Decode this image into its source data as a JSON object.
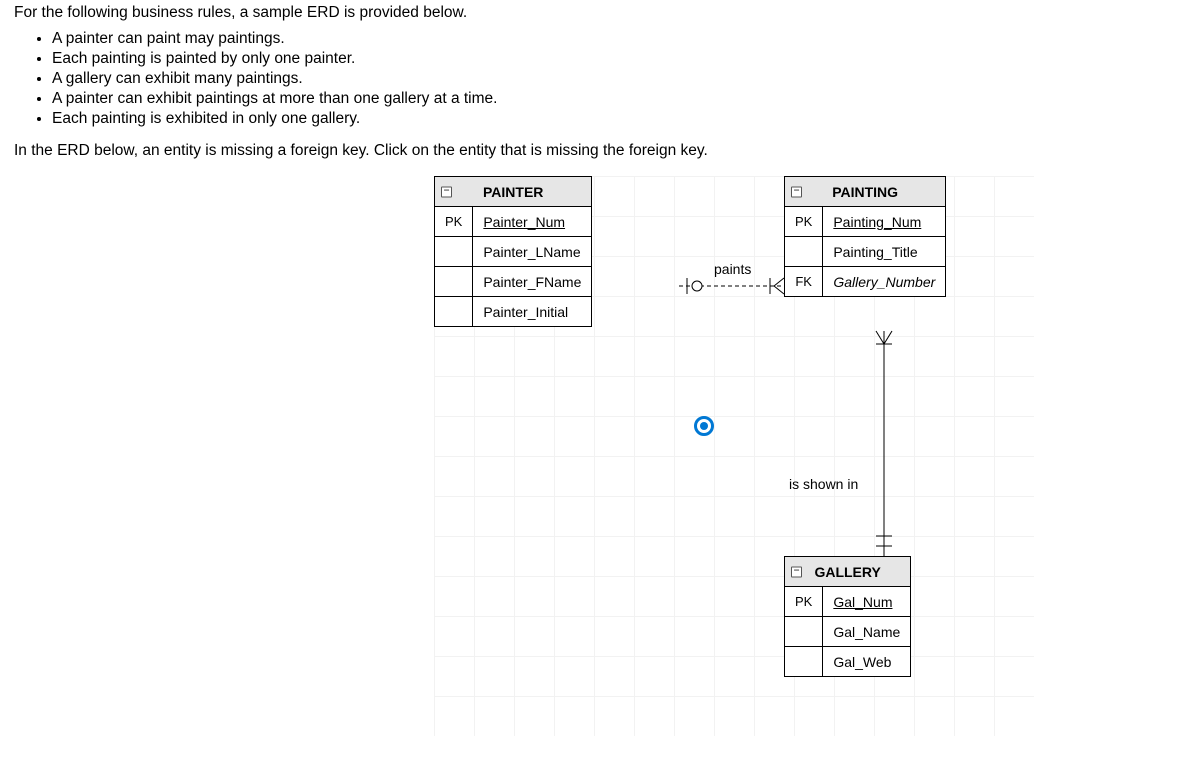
{
  "intro": "For the following business rules, a sample ERD is provided below.",
  "rules": [
    "A painter can paint may paintings.",
    "Each painting is painted by only one painter.",
    "A gallery can exhibit many paintings.",
    "A painter can exhibit paintings at more than one gallery at a time.",
    "Each painting is exhibited in only one gallery."
  ],
  "instruction": "In the ERD below, an entity is missing a foreign key. Click on the entity that is missing the foreign key.",
  "entities": {
    "painter": {
      "name": "PAINTER",
      "rows": [
        {
          "key": "PK",
          "attr": "Painter_Num",
          "pk": true
        },
        {
          "key": "",
          "attr": "Painter_LName"
        },
        {
          "key": "",
          "attr": "Painter_FName"
        },
        {
          "key": "",
          "attr": "Painter_Initial"
        }
      ]
    },
    "painting": {
      "name": "PAINTING",
      "rows": [
        {
          "key": "PK",
          "attr": "Painting_Num",
          "pk": true
        },
        {
          "key": "",
          "attr": "Painting_Title"
        },
        {
          "key": "FK",
          "attr": "Gallery_Number",
          "fk": true
        }
      ]
    },
    "gallery": {
      "name": "GALLERY",
      "rows": [
        {
          "key": "PK",
          "attr": "Gal_Num",
          "pk": true
        },
        {
          "key": "",
          "attr": "Gal_Name"
        },
        {
          "key": "",
          "attr": "Gal_Web"
        }
      ]
    }
  },
  "relationships": {
    "paints": "paints",
    "shown": "is shown in"
  }
}
